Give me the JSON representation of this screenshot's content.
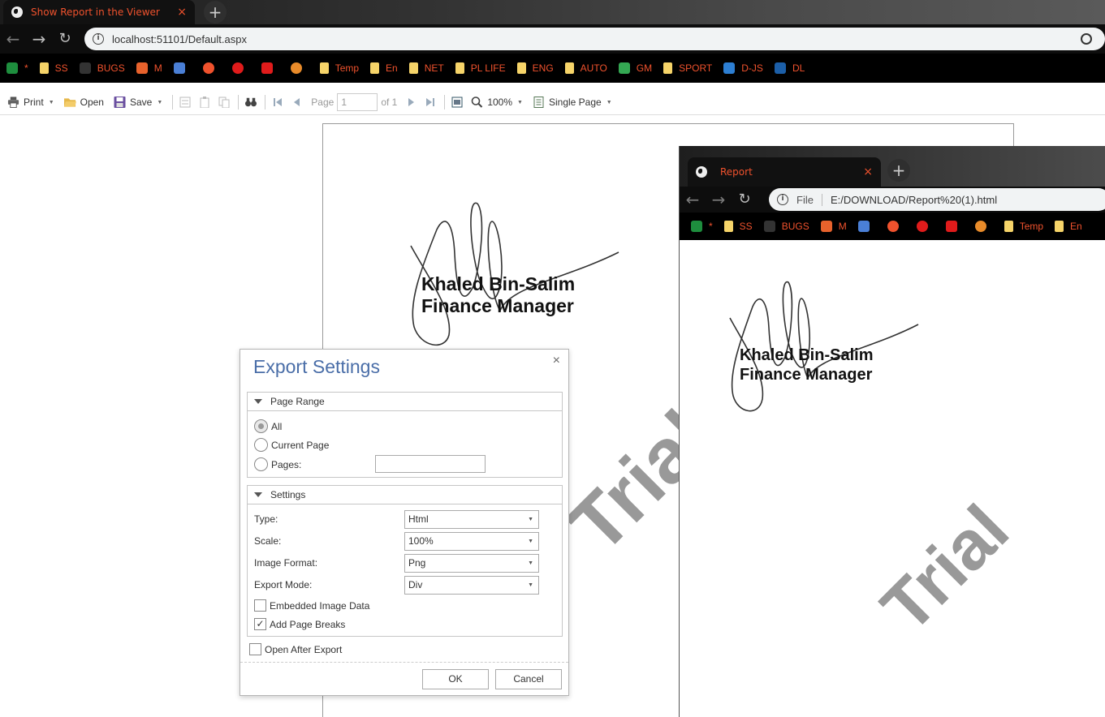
{
  "main_browser": {
    "tab_title": "Show Report in the Viewer",
    "tab_close": "×",
    "new_tab": "+",
    "url": "localhost:51101/Default.aspx",
    "bookmarks": [
      {
        "label": "*",
        "icon": "sheets-icon",
        "color": "#1e8e3e"
      },
      {
        "label": "SS",
        "icon": "folder-icon",
        "color": "#f6d469"
      },
      {
        "label": "BUGS",
        "icon": "github-icon",
        "color": "#333333"
      },
      {
        "label": "M",
        "icon": "m-app-icon",
        "color": "#e8622c"
      },
      {
        "label": "",
        "icon": "translate-icon",
        "color": "#4a7fd6"
      },
      {
        "label": "",
        "icon": "music-icon",
        "color": "#f0522d"
      },
      {
        "label": "",
        "icon": "youtube-music-icon",
        "color": "#e01b1b"
      },
      {
        "label": "",
        "icon": "youtube-icon",
        "color": "#e01b1b"
      },
      {
        "label": "",
        "icon": "orange-ball-icon",
        "color": "#e88b2a"
      },
      {
        "label": "Temp",
        "icon": "folder-icon",
        "color": "#f6d469"
      },
      {
        "label": "En",
        "icon": "folder-icon",
        "color": "#f6d469"
      },
      {
        "label": "NET",
        "icon": "folder-icon",
        "color": "#f6d469"
      },
      {
        "label": "PL LIFE",
        "icon": "folder-icon",
        "color": "#f6d469"
      },
      {
        "label": "ENG",
        "icon": "folder-icon",
        "color": "#f6d469"
      },
      {
        "label": "AUTO",
        "icon": "folder-icon",
        "color": "#f6d469"
      },
      {
        "label": "GM",
        "icon": "maps-pin-icon",
        "color": "#34a853"
      },
      {
        "label": "SPORT",
        "icon": "folder-icon",
        "color": "#f6d469"
      },
      {
        "label": "D-JS",
        "icon": "d-js-icon",
        "color": "#2d7fd3"
      },
      {
        "label": "DL",
        "icon": "dl-hex-icon",
        "color": "#1c5fa8"
      }
    ]
  },
  "toolbar": {
    "print": "Print",
    "open": "Open",
    "save": "Save",
    "page_label": "Page",
    "page_value": "1",
    "page_of": "of 1",
    "zoom": "100%",
    "view_mode": "Single Page"
  },
  "report": {
    "name": "Khaled Bin-Salim",
    "role": "Finance Manager",
    "watermark": "Trial"
  },
  "export_dialog": {
    "title": "Export Settings",
    "close": "×",
    "page_range_header": "Page Range",
    "range_options": [
      {
        "label": "All",
        "selected": true
      },
      {
        "label": "Current Page",
        "selected": false
      },
      {
        "label": "Pages:",
        "selected": false
      }
    ],
    "settings_header": "Settings",
    "settings": [
      {
        "label": "Type:",
        "value": "Html"
      },
      {
        "label": "Scale:",
        "value": "100%"
      },
      {
        "label": "Image Format:",
        "value": "Png"
      },
      {
        "label": "Export Mode:",
        "value": "Div"
      }
    ],
    "embedded_image_data": {
      "label": "Embedded Image Data",
      "checked": false
    },
    "add_page_breaks": {
      "label": "Add Page Breaks",
      "checked": true
    },
    "open_after_export": {
      "label": "Open After Export",
      "checked": false
    },
    "ok": "OK",
    "cancel": "Cancel"
  },
  "second_browser": {
    "tab_title": "Report",
    "tab_close": "×",
    "new_tab": "+",
    "file_label": "File",
    "url": "E:/DOWNLOAD/Report%20(1).html",
    "bookmarks": [
      {
        "label": "*",
        "icon": "sheets-icon",
        "color": "#1e8e3e"
      },
      {
        "label": "SS",
        "icon": "folder-icon",
        "color": "#f6d469"
      },
      {
        "label": "BUGS",
        "icon": "github-icon",
        "color": "#333333"
      },
      {
        "label": "M",
        "icon": "m-app-icon",
        "color": "#e8622c"
      },
      {
        "label": "",
        "icon": "translate-icon",
        "color": "#4a7fd6"
      },
      {
        "label": "",
        "icon": "music-icon",
        "color": "#f0522d"
      },
      {
        "label": "",
        "icon": "youtube-music-icon",
        "color": "#e01b1b"
      },
      {
        "label": "",
        "icon": "youtube-icon",
        "color": "#e01b1b"
      },
      {
        "label": "",
        "icon": "orange-ball-icon",
        "color": "#e88b2a"
      },
      {
        "label": "Temp",
        "icon": "folder-icon",
        "color": "#f6d469"
      },
      {
        "label": "En",
        "icon": "folder-icon",
        "color": "#f6d469"
      }
    ],
    "report_name": "Khaled Bin-Salim",
    "report_role": "Finance Manager",
    "watermark": "Trial"
  }
}
